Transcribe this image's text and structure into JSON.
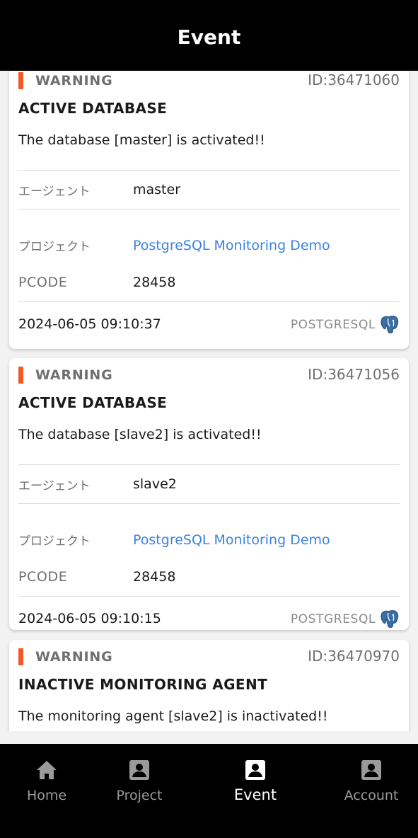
{
  "header": {
    "title": "Event"
  },
  "colors": {
    "warning": "#f05a28",
    "link": "#3b82e0",
    "bar": "#000000"
  },
  "events": [
    {
      "severity": "WARNING",
      "id": "ID:36471060",
      "title": "ACTIVE DATABASE",
      "message": "The database [master] is activated!!",
      "agent_label": "エージェント",
      "agent": "master",
      "project_label": "プロジェクト",
      "project": "PostgreSQL Monitoring Demo",
      "pcode_label": "PCODE",
      "pcode": "28458",
      "timestamp": "2024-06-05 09:10:37",
      "platform": "POSTGRESQL",
      "platform_icon": "postgresql-elephant-icon"
    },
    {
      "severity": "WARNING",
      "id": "ID:36471056",
      "title": "ACTIVE DATABASE",
      "message": "The database [slave2] is activated!!",
      "agent_label": "エージェント",
      "agent": "slave2",
      "project_label": "プロジェクト",
      "project": "PostgreSQL Monitoring Demo",
      "pcode_label": "PCODE",
      "pcode": "28458",
      "timestamp": "2024-06-05 09:10:15",
      "platform": "POSTGRESQL",
      "platform_icon": "postgresql-elephant-icon"
    },
    {
      "severity": "WARNING",
      "id": "ID:36470970",
      "title": "INACTIVE MONITORING AGENT",
      "message": "The monitoring agent [slave2] is inactivated!!"
    }
  ],
  "tabs": [
    {
      "label": "Home",
      "icon": "home-icon",
      "active": false
    },
    {
      "label": "Project",
      "icon": "project-icon",
      "active": false
    },
    {
      "label": "Event",
      "icon": "event-icon",
      "active": true
    },
    {
      "label": "Account",
      "icon": "account-icon",
      "active": false
    }
  ]
}
